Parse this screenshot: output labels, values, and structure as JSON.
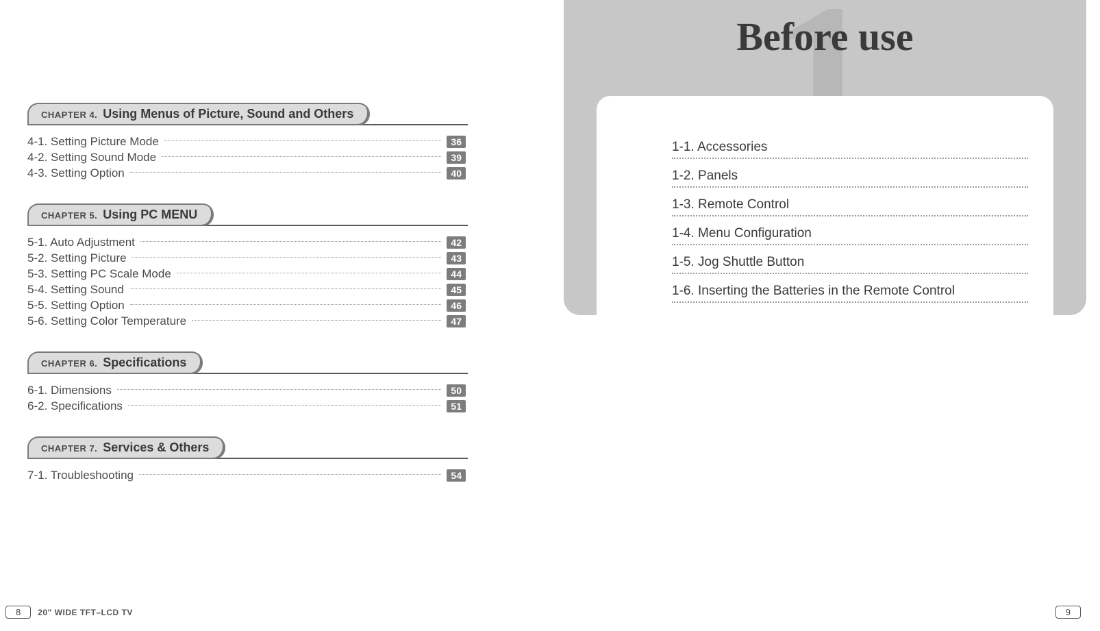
{
  "left_page": {
    "chapters": [
      {
        "label": "CHAPTER 4.",
        "title": "Using Menus of Picture, Sound and Others",
        "items": [
          {
            "label": "4-1. Setting Picture Mode",
            "page": "36"
          },
          {
            "label": "4-2. Setting Sound Mode",
            "page": "39"
          },
          {
            "label": "4-3. Setting Option",
            "page": "40"
          }
        ]
      },
      {
        "label": "CHAPTER 5.",
        "title": "Using PC MENU",
        "items": [
          {
            "label": "5-1. Auto Adjustment",
            "page": "42"
          },
          {
            "label": "5-2. Setting Picture",
            "page": "43"
          },
          {
            "label": "5-3. Setting PC Scale Mode",
            "page": "44"
          },
          {
            "label": "5-4. Setting Sound",
            "page": "45"
          },
          {
            "label": "5-5. Setting Option",
            "page": "46"
          },
          {
            "label": "5-6. Setting Color Temperature",
            "page": "47"
          }
        ]
      },
      {
        "label": "CHAPTER 6.",
        "title": "Specifications",
        "items": [
          {
            "label": "6-1. Dimensions",
            "page": "50"
          },
          {
            "label": "6-2. Specifications",
            "page": "51"
          }
        ]
      },
      {
        "label": "CHAPTER 7.",
        "title": "Services & Others",
        "items": [
          {
            "label": "7-1. Troubleshooting",
            "page": "54"
          }
        ]
      }
    ],
    "footer": {
      "page_number": "8",
      "text": "20″ WIDE TFT–LCD TV"
    }
  },
  "right_page": {
    "big_number": "1",
    "title": "Before use",
    "items": [
      "1-1. Accessories",
      "1-2. Panels",
      "1-3. Remote Control",
      "1-4. Menu Configuration",
      "1-5. Jog Shuttle Button",
      "1-6. Inserting the Batteries in the Remote Control"
    ],
    "footer": {
      "page_number": "9"
    }
  }
}
